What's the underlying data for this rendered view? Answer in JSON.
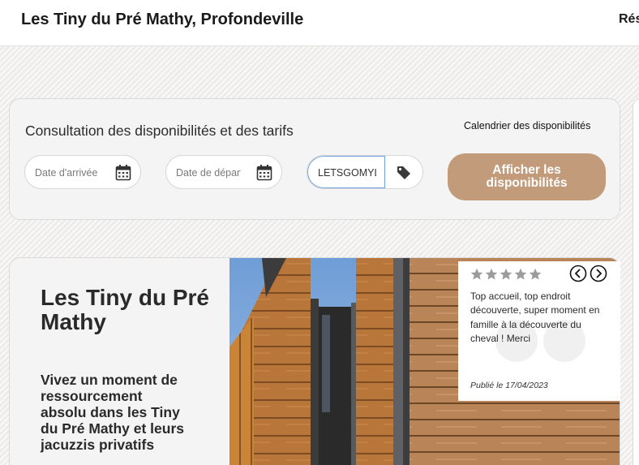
{
  "header": {
    "site_title": "Les Tiny du Pré Mathy, Profondeville",
    "nav_item": "Rés"
  },
  "booking": {
    "title": "Consultation des disponibilités et des tarifs",
    "calendar_link": "Calendrier des disponibilités",
    "arrival_placeholder": "Date d'arrivée",
    "departure_placeholder": "Date de départ",
    "promo_value": "LETSGOMYLOVE",
    "submit_label": "Afficher les disponibilités"
  },
  "listing": {
    "title": "Les Tiny du Pré Mathy",
    "tagline": "Vivez un moment de ressourcement absolu dans les Tiny du Pré Mathy et leurs jacuzzis privatifs"
  },
  "review": {
    "rating": 5,
    "text": "Top accueil, top endroit découverte, super moment en famille à la découverte du cheval ! Merci",
    "date": "Publié le 17/04/2023"
  },
  "colors": {
    "accent": "#c29b7b",
    "star": "#9c9c9c",
    "focus_border": "#6fa3e0"
  },
  "icons": [
    "calendar-icon",
    "tag-icon",
    "star-icon",
    "chevron-left-icon",
    "chevron-right-icon"
  ]
}
